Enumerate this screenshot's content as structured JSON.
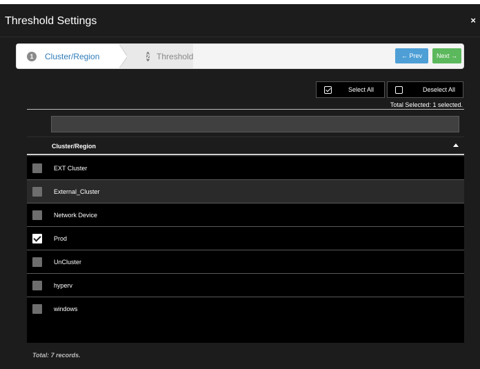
{
  "dialog": {
    "title": "Threshold Settings",
    "close_label": "×"
  },
  "wizard": {
    "steps": [
      {
        "number": "1",
        "label": "Cluster/Region",
        "active": true
      },
      {
        "number": "2",
        "label": "Threshold",
        "active": false
      }
    ],
    "prev_label": "← Prev",
    "next_label": "Next →"
  },
  "selection": {
    "select_all_label": "Select All",
    "deselect_all_label": "Deselect All",
    "total_selected": "Total Selected: 1 selected."
  },
  "filter": {
    "value": "",
    "placeholder": ""
  },
  "table": {
    "column_header": "Cluster/Region",
    "sort_icon": "sort-ascending-icon",
    "rows": [
      {
        "label": "EXT Cluster",
        "checked": false
      },
      {
        "label": "External_Cluster",
        "checked": false
      },
      {
        "label": "Network Device",
        "checked": false
      },
      {
        "label": "Prod",
        "checked": true
      },
      {
        "label": "UnCluster",
        "checked": false
      },
      {
        "label": "hyperv",
        "checked": false
      },
      {
        "label": "windows",
        "checked": false
      }
    ],
    "total_records": "Total: 7 records."
  },
  "colors": {
    "dialog_bg": "#1c1c1c",
    "active_step": "#2f7bb8",
    "prev_button": "#4e9fd6",
    "next_button": "#5cb85c"
  }
}
